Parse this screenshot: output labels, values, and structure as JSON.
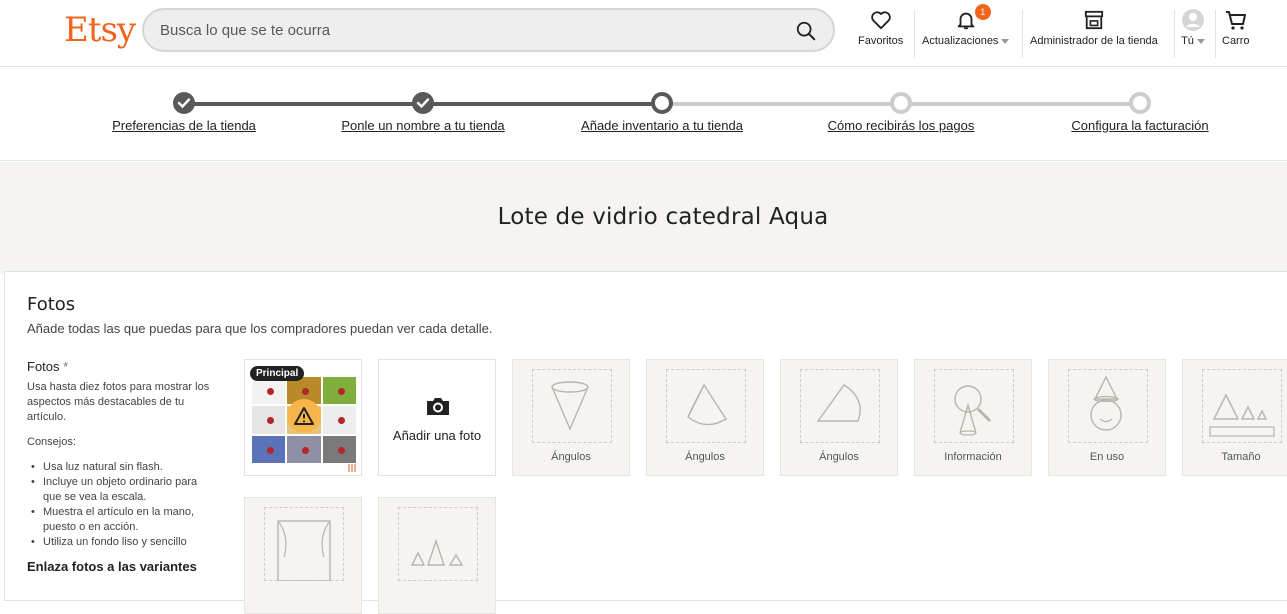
{
  "header": {
    "logo": "Etsy",
    "search_placeholder": "Busca lo que se te ocurra",
    "nav": {
      "favorites": "Favoritos",
      "updates": "Actualizaciones",
      "updates_badge": "1",
      "shop_manager": "Administrador de la tienda",
      "you": "Tú",
      "cart": "Carro"
    }
  },
  "stepper": {
    "steps": [
      {
        "label": "Preferencias de la tienda",
        "state": "done"
      },
      {
        "label": "Ponle un nombre a tu tienda",
        "state": "done"
      },
      {
        "label": "Añade inventario a tu tienda",
        "state": "current"
      },
      {
        "label": "Cómo recibirás los pagos",
        "state": "todo"
      },
      {
        "label": "Configura la facturación",
        "state": "todo"
      }
    ]
  },
  "listing_title": "Lote de vidrio catedral Aqua",
  "photos_section": {
    "title": "Fotos",
    "subtitle": "Añade todas las que puedas para que los compradores puedan ver cada detalle.",
    "side": {
      "label": "Fotos",
      "required_mark": "*",
      "description": "Usa hasta diez fotos para mostrar los aspectos más destacables de tu artículo.",
      "tips_title": "Consejos:",
      "tips": [
        "Usa luz natural sin flash.",
        "Incluye un objeto ordinario para que se vea la escala.",
        "Muestra el artículo en la mano, puesto o en acción.",
        "Utiliza un fondo liso y sencillo"
      ],
      "variants_title": "Enlaza fotos a las variantes"
    },
    "main_badge": "Principal",
    "add_photo_label": "Añadir una foto",
    "placeholders": [
      {
        "caption": "Ángulos",
        "icon": "cone-angle-icon"
      },
      {
        "caption": "Ángulos",
        "icon": "cone-tilted-icon"
      },
      {
        "caption": "Ángulos",
        "icon": "cone-side-icon"
      },
      {
        "caption": "Información",
        "icon": "magnifier-cone-icon"
      },
      {
        "caption": "En uso",
        "icon": "cone-hat-person-icon"
      },
      {
        "caption": "Tamaño",
        "icon": "cones-ruler-icon"
      },
      {
        "caption": "",
        "icon": "window-scene-icon"
      },
      {
        "caption": "",
        "icon": "cones-group-icon"
      }
    ],
    "photo_grid_colors": [
      "#f2f2f2",
      "#b98a2a",
      "#7fae3c",
      "#e5e5e5",
      "#e8c37a",
      "#ededed",
      "#5a73b8",
      "#8f8fa6",
      "#7a7a7a"
    ]
  },
  "colors": {
    "brand": "#f1641e",
    "band_bg": "#f5f4f0",
    "step_done": "#595959",
    "step_todo": "#cccccc"
  }
}
